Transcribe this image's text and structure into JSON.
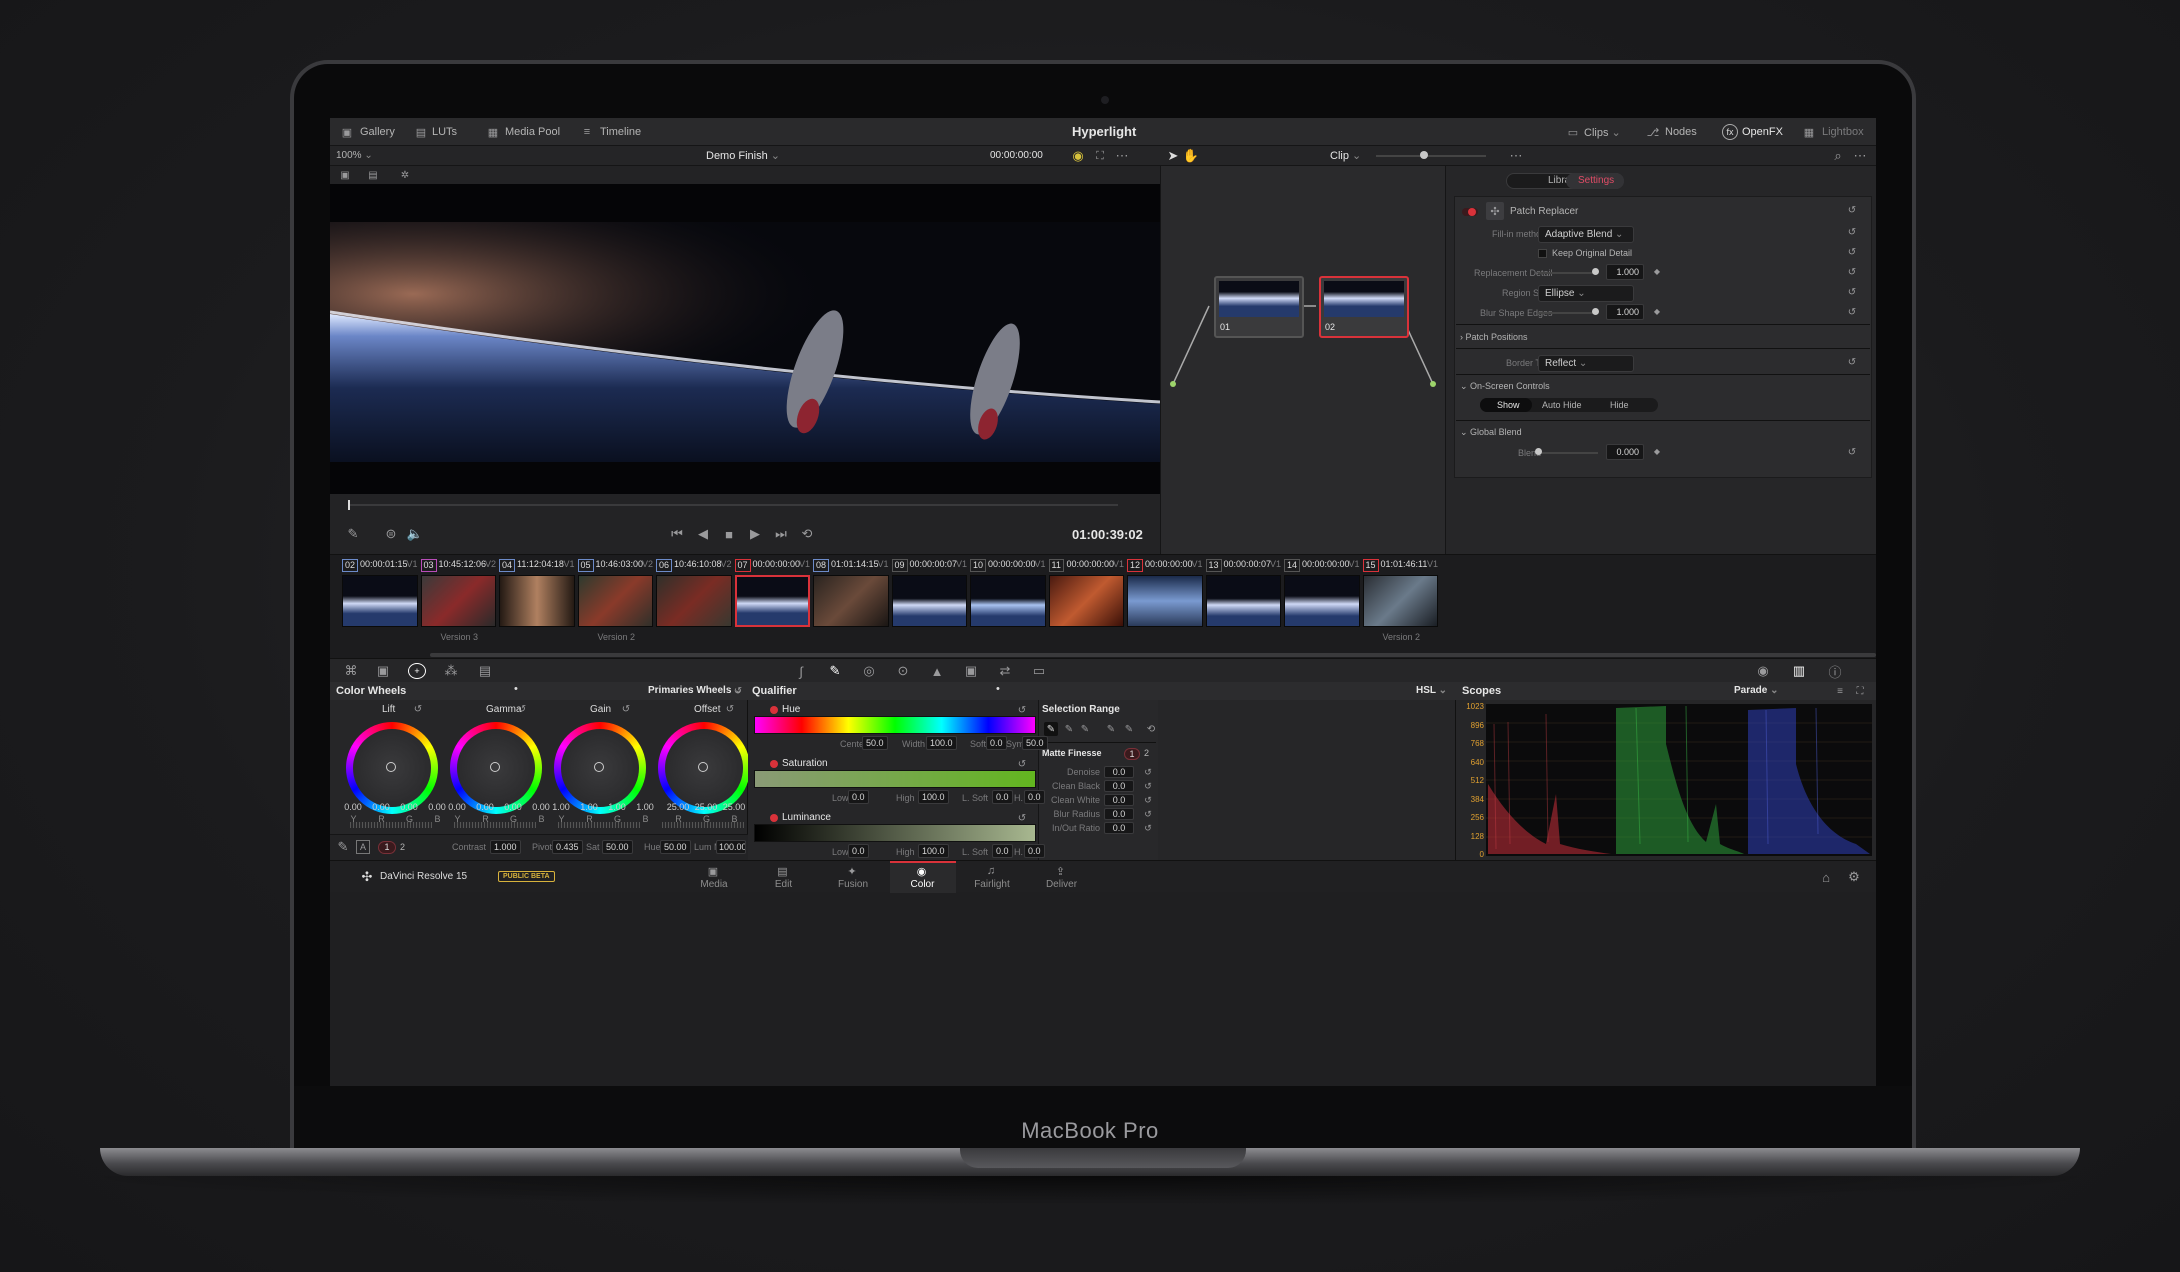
{
  "device": {
    "label": "MacBook Pro"
  },
  "app": {
    "title": "Hyperlight",
    "product": "DaVinci Resolve 15",
    "badge": "PUBLIC BETA"
  },
  "top_tabs": {
    "left": [
      "Gallery",
      "LUTs",
      "Media Pool",
      "Timeline"
    ],
    "right": [
      "Clips",
      "Nodes",
      "OpenFX",
      "Lightbox"
    ]
  },
  "viewer": {
    "zoom": "100%",
    "timeline_name": "Demo Finish",
    "source_timecode": "00:00:00:00",
    "playhead_timecode": "01:00:39:02",
    "node_mode": "Clip"
  },
  "openfx": {
    "tabs": [
      "Library",
      "Settings"
    ],
    "active_tab": "Settings",
    "effect": "Patch Replacer",
    "fill_in_method_label": "Fill-in method",
    "fill_in_method": "Adaptive Blend",
    "keep_original_detail": "Keep Original Detail",
    "replacement_detail_label": "Replacement Detail",
    "replacement_detail": "1.000",
    "replacement_detail_level": 0.95,
    "region_shape_label": "Region Shape",
    "region_shape": "Ellipse",
    "blur_shape_edges_label": "Blur Shape Edges",
    "blur_shape_edges": "1.000",
    "blur_shape_edges_level": 0.95,
    "patch_positions": "Patch Positions",
    "border_type_label": "Border Type",
    "border_type": "Reflect",
    "on_screen_controls": "On-Screen Controls",
    "osc_buttons": [
      "Show",
      "Auto Hide",
      "Hide"
    ],
    "osc_active": "Show",
    "global_blend": "Global Blend",
    "blend_label": "Blend",
    "blend": "0.000",
    "blend_level": 0.0
  },
  "nodes": [
    {
      "label": "01"
    },
    {
      "label": "02"
    }
  ],
  "clips": [
    {
      "num": "02",
      "tc": "00:00:01:15",
      "track": "V1",
      "version": "",
      "color": "#6c8bc9"
    },
    {
      "num": "03",
      "tc": "10:45:12:06",
      "track": "V2",
      "version": "Version 3",
      "color": "#b84db8"
    },
    {
      "num": "04",
      "tc": "11:12:04:18",
      "track": "V1",
      "version": "",
      "color": "#6c8bc9"
    },
    {
      "num": "05",
      "tc": "10:46:03:00",
      "track": "V2",
      "version": "Version 2",
      "color": "#6c8bc9"
    },
    {
      "num": "06",
      "tc": "10:46:10:08",
      "track": "V2",
      "version": "",
      "color": "#6c8bc9"
    },
    {
      "num": "07",
      "tc": "00:00:00:00",
      "track": "V1",
      "version": "",
      "color": "#d9323a"
    },
    {
      "num": "08",
      "tc": "01:01:14:15",
      "track": "V1",
      "version": "",
      "color": "#6c8bc9"
    },
    {
      "num": "09",
      "tc": "00:00:00:07",
      "track": "V1",
      "version": "",
      "color": ""
    },
    {
      "num": "10",
      "tc": "00:00:00:00",
      "track": "V1",
      "version": "",
      "color": ""
    },
    {
      "num": "11",
      "tc": "00:00:00:00",
      "track": "V1",
      "version": "",
      "color": ""
    },
    {
      "num": "12",
      "tc": "00:00:00:00",
      "track": "V1",
      "version": "",
      "color": "#d9323a"
    },
    {
      "num": "13",
      "tc": "00:00:00:07",
      "track": "V1",
      "version": "",
      "color": ""
    },
    {
      "num": "14",
      "tc": "00:00:00:00",
      "track": "V1",
      "version": "",
      "color": ""
    },
    {
      "num": "15",
      "tc": "01:01:46:11",
      "track": "V1",
      "version": "Version 2",
      "color": "#d9323a"
    }
  ],
  "color_wheels": {
    "title": "Color Wheels",
    "mode": "Primaries Wheels",
    "wheels": [
      {
        "name": "Lift",
        "values": [
          "0.00",
          "0.00",
          "0.00",
          "0.00"
        ],
        "channels": [
          "Y",
          "R",
          "G",
          "B"
        ]
      },
      {
        "name": "Gamma",
        "values": [
          "0.00",
          "0.00",
          "0.00",
          "0.00"
        ],
        "channels": [
          "Y",
          "R",
          "G",
          "B"
        ]
      },
      {
        "name": "Gain",
        "values": [
          "1.00",
          "1.00",
          "1.00",
          "1.00"
        ],
        "channels": [
          "Y",
          "R",
          "G",
          "B"
        ]
      },
      {
        "name": "Offset",
        "values": [
          "25.00",
          "25.00",
          "25.00"
        ],
        "channels": [
          "R",
          "G",
          "B"
        ]
      }
    ],
    "page_a": "1",
    "page_b": "2",
    "contrast_label": "Contrast",
    "contrast": "1.000",
    "pivot_label": "Pivot",
    "pivot": "0.435",
    "sat_label": "Sat",
    "sat": "50.00",
    "hue_label": "Hue",
    "hue": "50.00",
    "lum_mix_label": "Lum Mix",
    "lum_mix": "100.00"
  },
  "qualifier": {
    "title": "Qualifier",
    "mode": "HSL",
    "hue": {
      "label": "Hue",
      "center_label": "Center",
      "center": "50.0",
      "width_label": "Width",
      "width": "100.0",
      "soft_label": "Soft",
      "soft": "0.0",
      "sym_label": "Sym",
      "sym": "50.0"
    },
    "saturation": {
      "label": "Saturation",
      "low_label": "Low",
      "low": "0.0",
      "high_label": "High",
      "high": "100.0",
      "lsoft_label": "L. Soft",
      "lsoft": "0.0",
      "hsoft_label": "H. Soft",
      "hsoft": "0.0"
    },
    "luminance": {
      "label": "Luminance",
      "low_label": "Low",
      "low": "0.0",
      "high_label": "High",
      "high": "100.0",
      "lsoft_label": "L. Soft",
      "lsoft": "0.0",
      "hsoft_label": "H. Soft",
      "hsoft": "0.0"
    },
    "selection_range": "Selection Range",
    "matte_finesse": "Matte Finesse",
    "mf_page_a": "1",
    "mf_page_b": "2",
    "finesse": [
      {
        "label": "Denoise",
        "value": "0.0"
      },
      {
        "label": "Clean Black",
        "value": "0.0"
      },
      {
        "label": "Clean White",
        "value": "0.0"
      },
      {
        "label": "Blur Radius",
        "value": "0.0"
      },
      {
        "label": "In/Out Ratio",
        "value": "0.0"
      }
    ]
  },
  "scopes": {
    "title": "Scopes",
    "mode": "Parade",
    "ticks": [
      "1023",
      "896",
      "768",
      "640",
      "512",
      "384",
      "256",
      "128",
      "0"
    ]
  },
  "pages": {
    "items": [
      "Media",
      "Edit",
      "Fusion",
      "Color",
      "Fairlight",
      "Deliver"
    ],
    "active": "Color"
  }
}
